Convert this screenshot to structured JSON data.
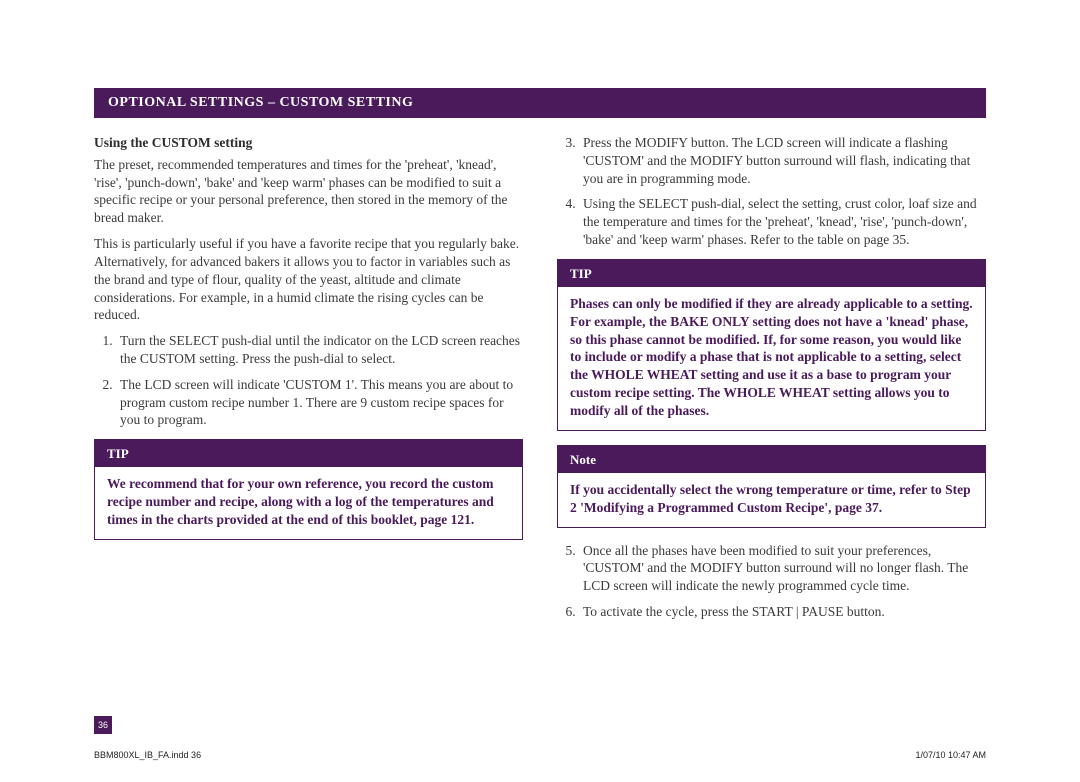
{
  "banner": "OPTIONAL SETTINGS – CUSTOM SETTING",
  "left": {
    "subhead": "Using the CUSTOM setting",
    "para1": "The preset, recommended temperatures and times for the 'preheat', 'knead', 'rise', 'punch-down', 'bake' and 'keep warm' phases can be modified to suit a specific recipe or your personal preference, then stored in the memory of the bread maker.",
    "para2": "This is particularly useful if you have a favorite recipe that you regularly bake. Alternatively, for advanced bakers it allows you to factor in variables such as the brand and type of flour, quality of the yeast, altitude and climate considerations. For example, in a humid climate the rising cycles can be reduced.",
    "steps": [
      "Turn the SELECT push-dial until the indicator on the LCD screen reaches the CUSTOM setting. Press the push-dial to select.",
      "The LCD screen will indicate 'CUSTOM 1'. This means you are about to program custom recipe number 1. There are 9 custom recipe spaces for you to program."
    ],
    "tip": {
      "head": "TIP",
      "body": "We recommend that for your own reference, you record the custom recipe number and recipe, along with a log of the temperatures and times in the charts provided at the end of this booklet, page 121."
    }
  },
  "right": {
    "steps_a": [
      "Press the MODIFY button. The LCD screen will indicate a flashing 'CUSTOM' and the MODIFY button surround will flash, indicating that you are in programming mode.",
      "Using the SELECT push-dial, select the setting, crust color, loaf size and the temperature and times for the 'preheat', 'knead', 'rise', 'punch-down', 'bake' and 'keep warm' phases. Refer to the table on page 35."
    ],
    "tip": {
      "head": "TIP",
      "body": "Phases can only be modified if they are already applicable to a setting. For example, the BAKE ONLY setting does not have a 'knead' phase, so this phase cannot be modified. If, for some reason, you would like to include or modify a phase that is not applicable to a setting, select the WHOLE WHEAT setting and use it as a base to program your custom recipe setting. The WHOLE WHEAT setting allows you to modify all of the phases."
    },
    "note": {
      "head": "Note",
      "body": "If you accidentally select the wrong temperature or time, refer to Step 2 'Modifying a Programmed Custom Recipe', page 37."
    },
    "steps_b": [
      "Once all the phases have been modified to suit your preferences, 'CUSTOM' and the MODIFY button surround will no longer flash. The LCD screen will indicate the newly programmed cycle time.",
      "To activate the cycle, press the START | PAUSE button."
    ]
  },
  "pagenum": "36",
  "footer": {
    "left": "BBM800XL_IB_FA.indd   36",
    "right": "1/07/10   10:47 AM"
  }
}
